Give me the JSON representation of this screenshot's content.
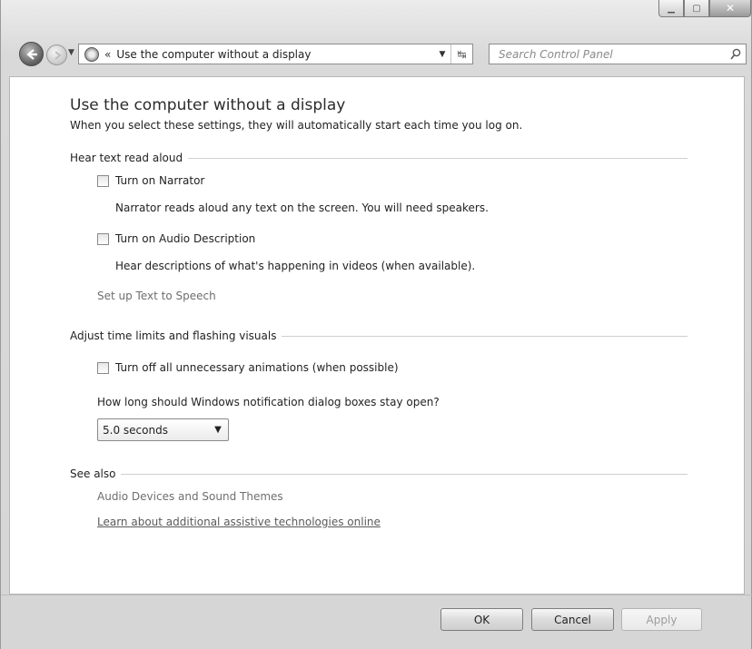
{
  "window": {
    "controls": {
      "minimize_icon": "minimize-icon",
      "maximize_icon": "maximize-icon",
      "close_icon": "close-icon"
    }
  },
  "nav": {
    "address_chevron": "«",
    "address_text": "Use the computer without a display",
    "search_placeholder": "Search Control Panel"
  },
  "page": {
    "title": "Use the computer without a display",
    "subtitle": "When you select these settings, they will automatically start each time you log on."
  },
  "sections": {
    "hear": {
      "label": "Hear text read aloud",
      "narrator_label": "Turn on Narrator",
      "narrator_checked": false,
      "narrator_desc": "Narrator reads aloud any text on the screen. You will need speakers.",
      "audio_desc_label": "Turn on Audio Description",
      "audio_desc_checked": false,
      "audio_desc_desc": "Hear descriptions of what's happening in videos (when available).",
      "tts_link": "Set up Text to Speech"
    },
    "time": {
      "label": "Adjust time limits and flashing visuals",
      "animations_label": "Turn off all unnecessary animations (when possible)",
      "animations_checked": false,
      "question": "How long should Windows notification dialog boxes stay open?",
      "duration_value": "5.0 seconds"
    },
    "see_also": {
      "label": "See also",
      "link1": "Audio Devices and Sound Themes",
      "link2": "Learn about additional assistive technologies online"
    }
  },
  "buttons": {
    "ok": "OK",
    "cancel": "Cancel",
    "apply": "Apply"
  }
}
